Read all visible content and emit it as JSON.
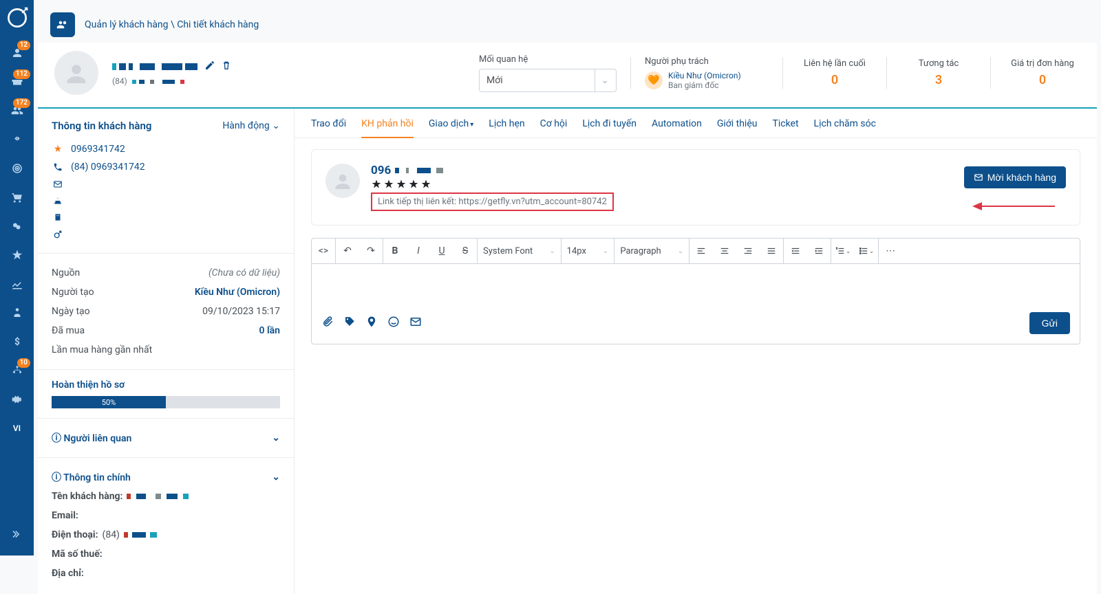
{
  "sidebar": {
    "badges": {
      "person": "12",
      "briefcase": "112",
      "users": "172",
      "org": "10"
    }
  },
  "lang": "VI",
  "breadcrumb": {
    "root": "Quản lý khách hàng",
    "sep": " \\ ",
    "current": "Chi tiết khách hàng"
  },
  "customer": {
    "phone_prefix": "(84)",
    "relationship_label": "Mối quan hệ",
    "relationship_value": "Mới",
    "owner_label": "Người phụ trách",
    "owner_name": "Kiều Như (Omicron)",
    "owner_role": "Ban giám đốc"
  },
  "stats": {
    "last_contact_label": "Liên hệ lần cuối",
    "last_contact_value": "0",
    "interact_label": "Tương tác",
    "interact_value": "3",
    "order_value_label": "Giá trị đơn hàng",
    "order_value": "0"
  },
  "left": {
    "title": "Thông tin khách hàng",
    "action": "Hành động",
    "phone1": "0969341742",
    "phone2": "(84) 0969341742",
    "source_label": "Nguồn",
    "source_value": "(Chưa có dữ liệu)",
    "creator_label": "Người tạo",
    "creator_value": "Kiều Như (Omicron)",
    "created_label": "Ngày tạo",
    "created_value": "09/10/2023 15:17",
    "purchased_label": "Đã mua",
    "purchased_value": "0 lần",
    "recent_label": "Lần mua hàng gần nhất",
    "profile_label": "Hoàn thiện hồ sơ",
    "profile_pct": "50%",
    "related_label": "Người liên quan",
    "main_info_label": "Thông tin chính",
    "name_label": "Tên khách hàng:",
    "email_label": "Email:",
    "phone_label": "Điện thoại:",
    "phone_val_prefix": "(84)",
    "tax_label": "Mã số thuế:",
    "address_label": "Địa chỉ:"
  },
  "tabs": [
    "Trao đổi",
    "KH phản hồi",
    "Giao dịch",
    "Lịch hẹn",
    "Cơ hội",
    "Lịch đi tuyến",
    "Automation",
    "Giới thiệu",
    "Ticket",
    "Lịch chăm sóc"
  ],
  "feedback": {
    "name_prefix": "096",
    "link_text": "Link tiếp thị liên kết: https://getfly.vn?utm_account=80742",
    "invite_label": "Mời khách hàng"
  },
  "editor": {
    "font": "System Font",
    "size": "14px",
    "para": "Paragraph",
    "send": "Gửi"
  }
}
